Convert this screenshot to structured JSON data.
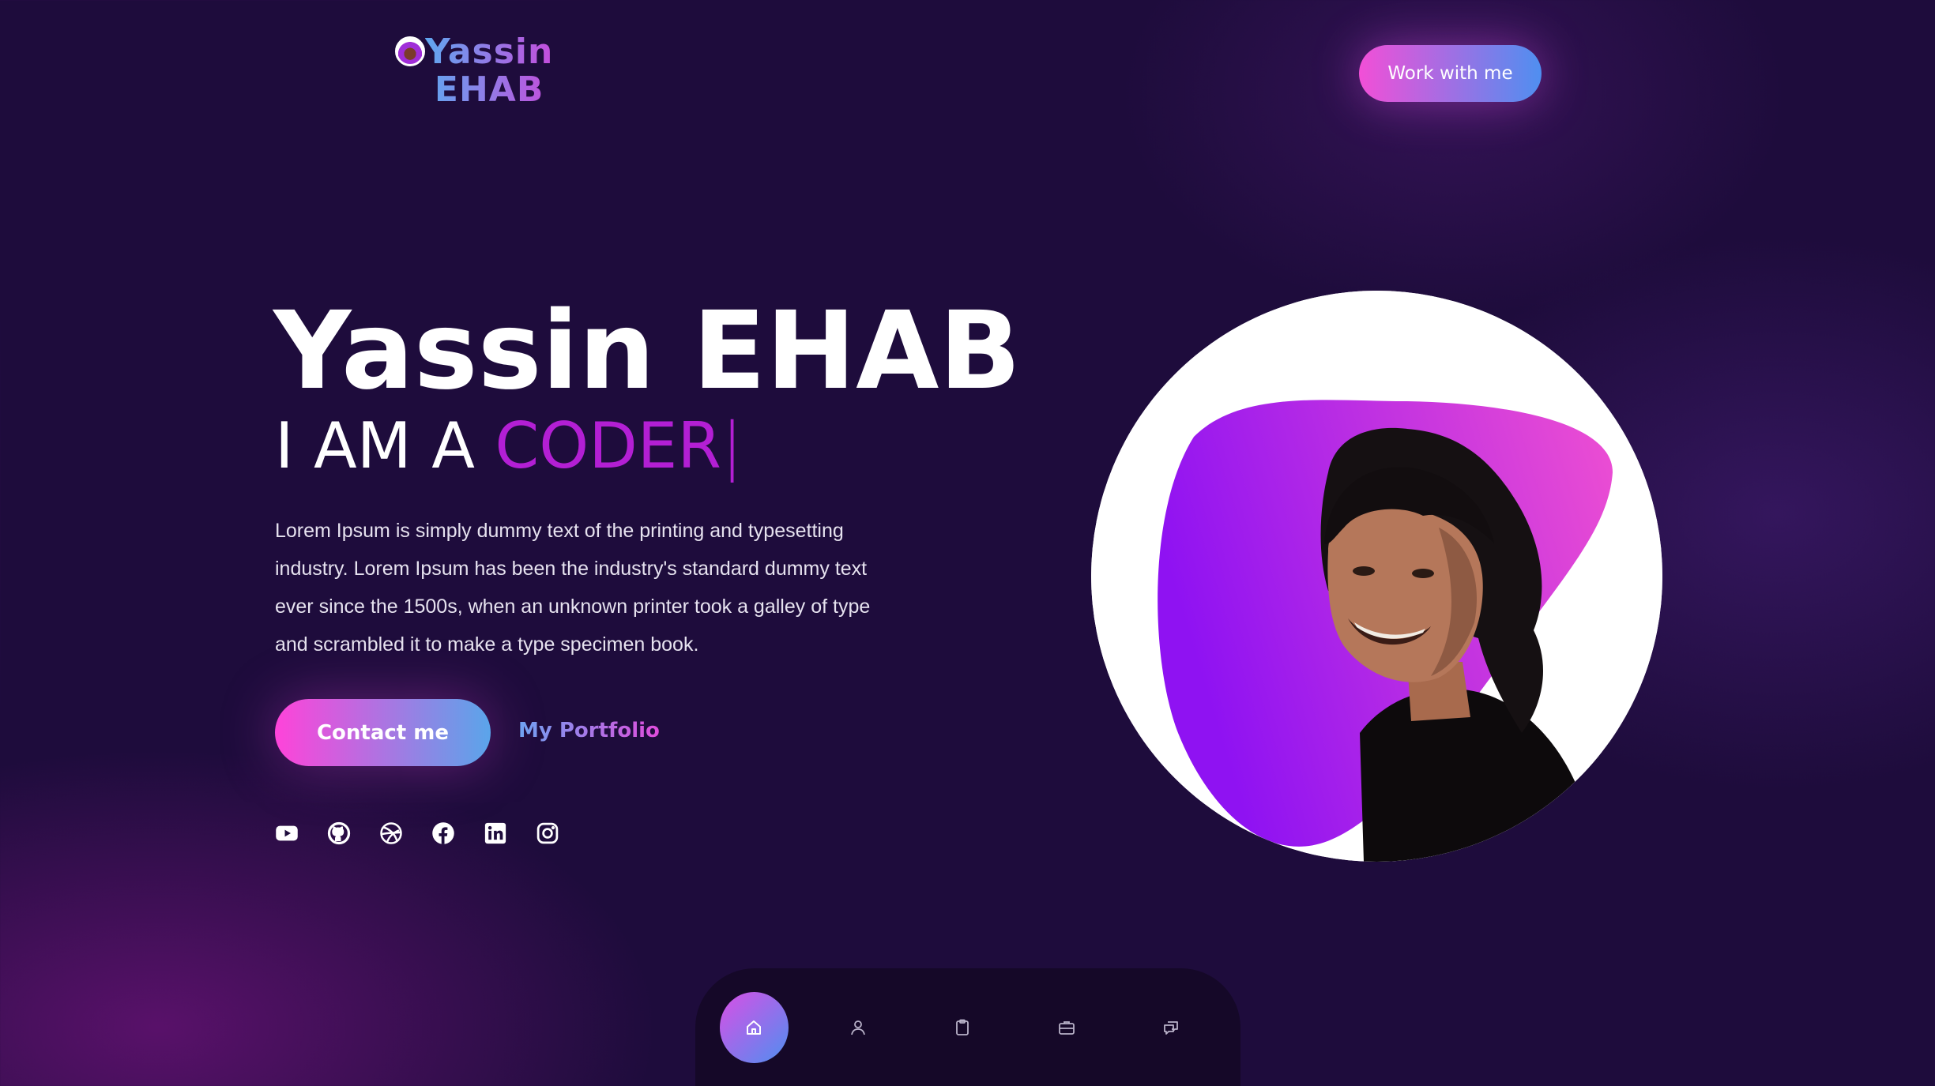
{
  "header": {
    "logo_line1": "Yassin",
    "logo_line2": "EHAB",
    "cta_label": "Work with me"
  },
  "hero": {
    "name": "Yassin EHAB",
    "role_prefix": "I AM A",
    "role_typed": "CODER",
    "role_cursor": "|",
    "description": "Lorem Ipsum is simply dummy text of the printing and typesetting industry. Lorem Ipsum has been the industry's standard dummy text ever since the 1500s, when an unknown printer took a galley of type and scrambled it to make a type specimen book.",
    "contact_label": "Contact me",
    "portfolio_label": "My Portfolio"
  },
  "socials": [
    "youtube-icon",
    "github-icon",
    "dribbble-icon",
    "facebook-icon",
    "linkedin-icon",
    "instagram-icon"
  ],
  "bottom_nav": {
    "items": [
      "home-icon",
      "user-icon",
      "clipboard-icon",
      "briefcase-icon",
      "chat-icon"
    ],
    "active": "home-icon"
  },
  "colors": {
    "background": "#1e0c3c",
    "accent_pink": "#f24fd7",
    "accent_blue": "#4f8ff0",
    "role_highlight": "#b31fd4"
  }
}
